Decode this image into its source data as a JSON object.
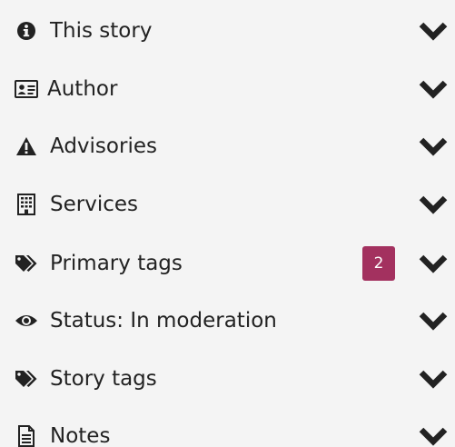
{
  "sections": [
    {
      "id": "this-story",
      "label": "This story",
      "icon": "info-icon"
    },
    {
      "id": "author",
      "label": "Author",
      "icon": "id-card-icon"
    },
    {
      "id": "advisories",
      "label": "Advisories",
      "icon": "warning-icon"
    },
    {
      "id": "services",
      "label": "Services",
      "icon": "building-icon"
    },
    {
      "id": "primary-tags",
      "label": "Primary tags",
      "icon": "tags-icon",
      "badge": "2"
    },
    {
      "id": "status",
      "label": "Status: In moderation",
      "icon": "eye-icon"
    },
    {
      "id": "story-tags",
      "label": "Story tags",
      "icon": "tags-icon"
    },
    {
      "id": "notes",
      "label": "Notes",
      "icon": "document-icon"
    }
  ],
  "chevron_icon": "chevron-down-icon",
  "colors": {
    "panel_background": "#f4f4f4",
    "text": "#222222",
    "badge": "#a3315f",
    "badge_text": "#ffffff"
  }
}
